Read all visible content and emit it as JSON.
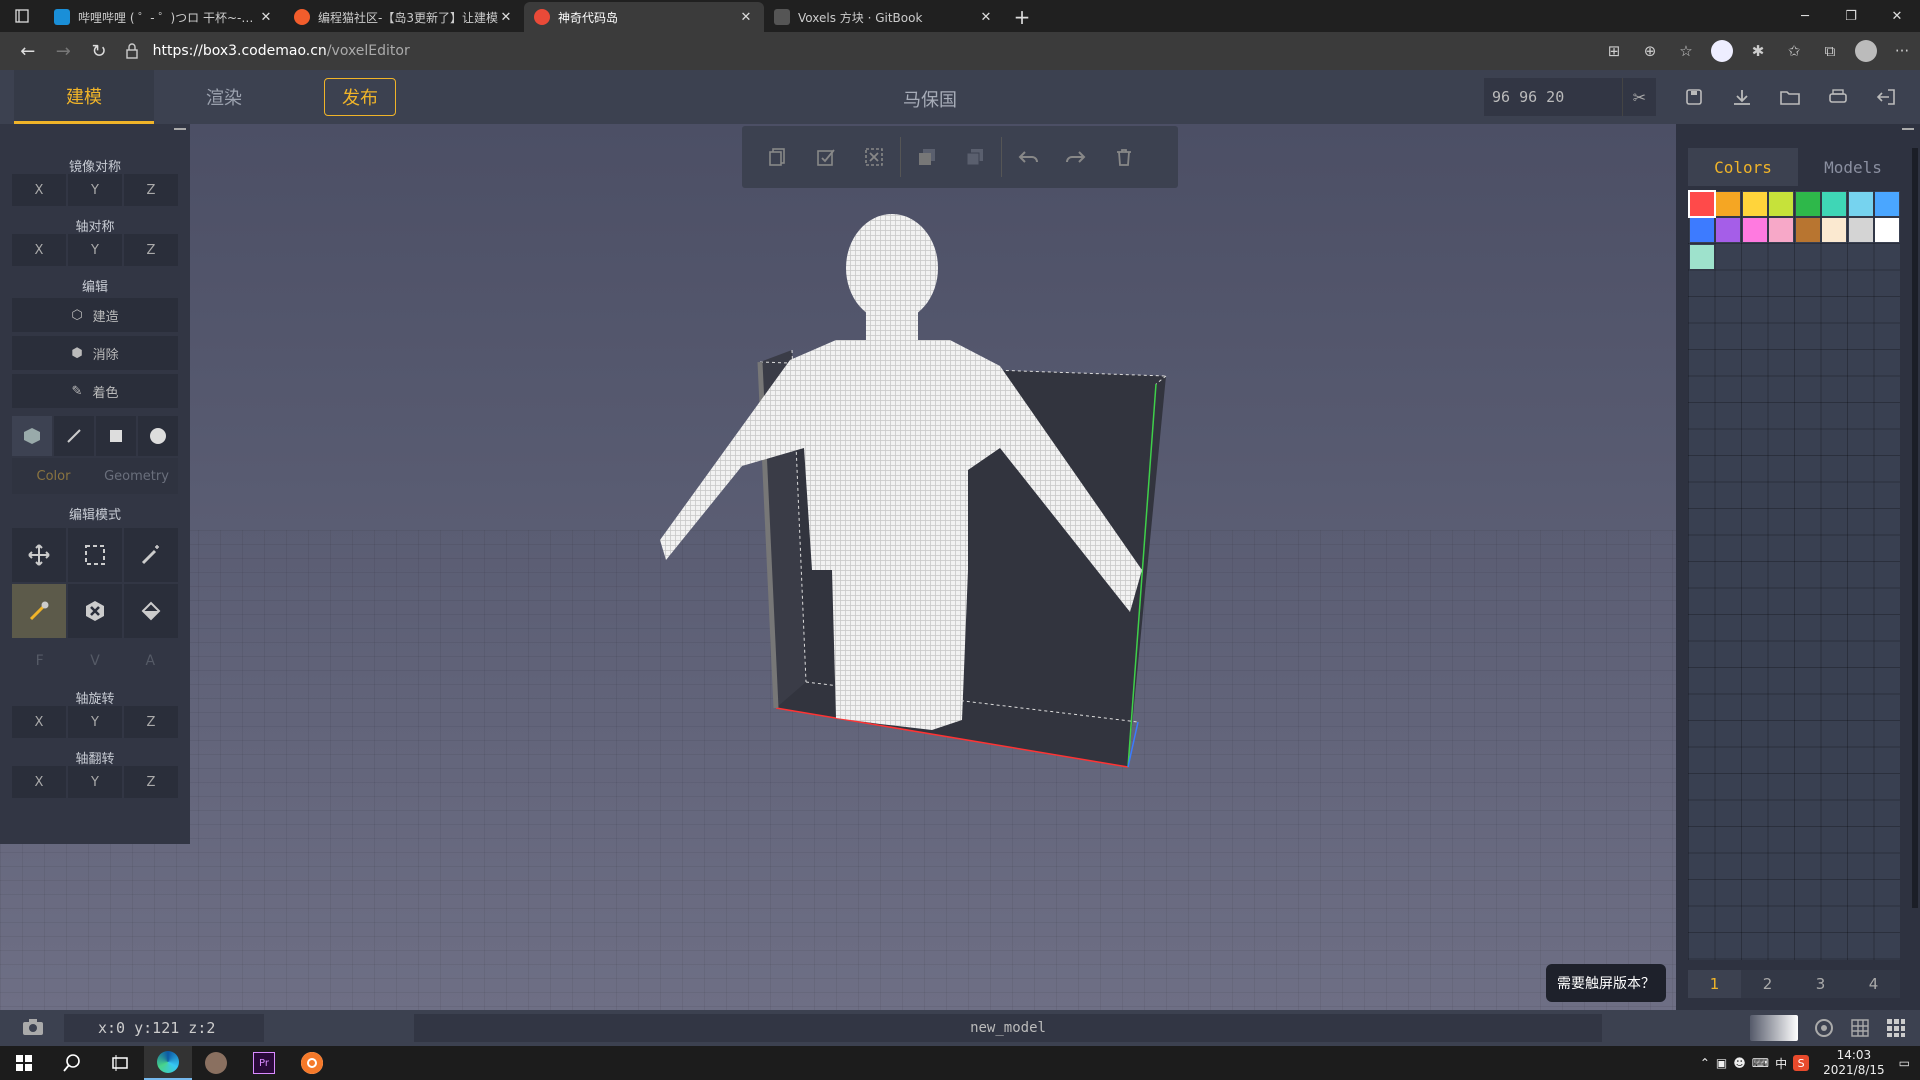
{
  "browser": {
    "tabs": [
      {
        "title": "哔哩哔哩 ( ゜- ゜)つロ 干杯~-bilibili",
        "color": "#1a8fd8",
        "active": false
      },
      {
        "title": "编程猫社区-【岛3更新了】让建模",
        "color": "#f25d2c",
        "active": false
      },
      {
        "title": "神奇代码岛",
        "color": "#e94a38",
        "active": true
      },
      {
        "title": "Voxels 方块 · GitBook",
        "color": "#555555",
        "active": false
      }
    ],
    "url_host": "https://box3.codemao.cn",
    "url_path": "/voxelEditor"
  },
  "app": {
    "tabs": [
      "建模",
      "渲染"
    ],
    "publish_label": "发布",
    "project_title": "马保国",
    "dims_value": "96 96 20"
  },
  "left": {
    "mirror_label": "镜像对称",
    "axis_sym_label": "轴对称",
    "edit_label": "编辑",
    "axes": [
      "X",
      "Y",
      "Z"
    ],
    "build_label": "建造",
    "erase_label": "消除",
    "paint_label": "着色",
    "color_label": "Color",
    "geometry_label": "Geometry",
    "mode_label": "编辑模式",
    "fva": [
      "F",
      "V",
      "A"
    ],
    "rotate_label": "轴旋转",
    "flip_label": "轴翻转"
  },
  "right": {
    "colors_tab": "Colors",
    "models_tab": "Models",
    "swatches": [
      "#ff4a4a",
      "#f5a623",
      "#ffd43b",
      "#c6e23a",
      "#2eb84a",
      "#3fd6b6",
      "#76d3ef",
      "#4aa6ff",
      "#3d7bff",
      "#a55ee8",
      "#ff7ae0",
      "#f7a8c8",
      "#b87530",
      "#fbe9d0",
      "#d4d4d4",
      "#ffffff",
      "#9ee2cc"
    ],
    "pages": [
      "1",
      "2",
      "3",
      "4"
    ],
    "tip": "需要触屏版本？"
  },
  "status": {
    "coords": "x:0 y:121 z:2",
    "model_name": "new_model"
  },
  "taskbar": {
    "ime": "中",
    "time": "14:03",
    "date": "2021/8/15"
  }
}
